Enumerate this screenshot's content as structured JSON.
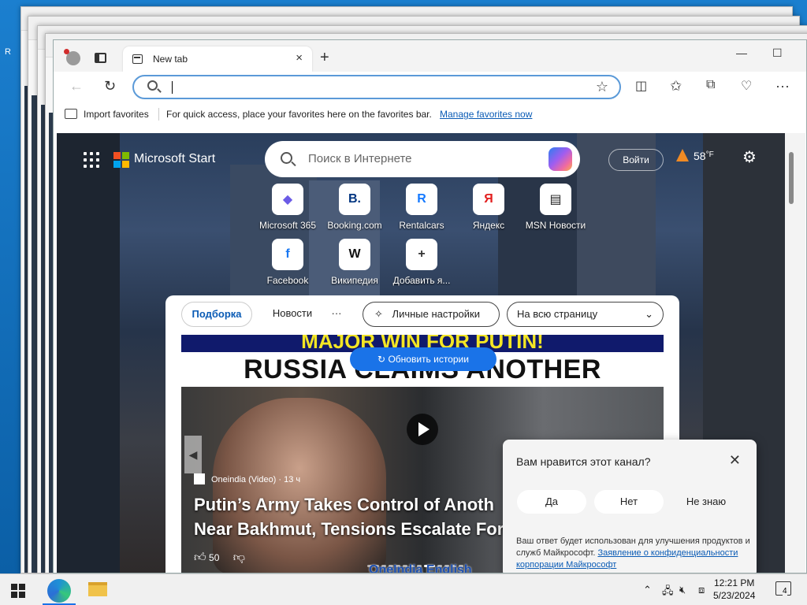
{
  "desktop": {
    "edge_text": "R"
  },
  "browser": {
    "tab": {
      "title": "New tab",
      "close": "×"
    },
    "new_tab": "+",
    "window_controls": {
      "minimize": "—",
      "maximize": "☐"
    },
    "address": {
      "value": "",
      "placeholder": ""
    },
    "favorites_bar": {
      "import_label": "Import favorites",
      "message": "For quick access, place your favorites here on the favorites bar.",
      "manage_link": "Manage favorites now"
    }
  },
  "page": {
    "brand": "Microsoft Start",
    "search_placeholder": "Поиск в Интернете",
    "login": "Войти",
    "weather": {
      "temp": "58",
      "unit": "°F"
    },
    "quick_links": [
      {
        "label": "Microsoft 365",
        "icon": "m365-icon",
        "glyph": "◆",
        "color": "#6b5be6"
      },
      {
        "label": "Booking.com",
        "icon": "booking-icon",
        "glyph": "B.",
        "color": "#003580"
      },
      {
        "label": "Rentalcars",
        "icon": "rentalcars-icon",
        "glyph": "R",
        "color": "#1479ff"
      },
      {
        "label": "Яндекс",
        "icon": "yandex-icon",
        "glyph": "Я",
        "color": "#e21e1e"
      },
      {
        "label": "MSN Новости",
        "icon": "msn-news-icon",
        "glyph": "▤",
        "color": "#222222"
      },
      {
        "label": "Facebook",
        "icon": "facebook-icon",
        "glyph": "f",
        "color": "#1877f2"
      },
      {
        "label": "Википедия",
        "icon": "wikipedia-icon",
        "glyph": "W",
        "color": "#111111"
      },
      {
        "label": "Добавить я...",
        "icon": "add-icon",
        "glyph": "+",
        "color": "#333333"
      }
    ],
    "feed_tabs": {
      "selected": "Подборка",
      "news": "Новости",
      "more": "···",
      "personalize": "Личные настройки",
      "layout": "На всю страницу"
    },
    "article": {
      "banner_top": "MAJOR WIN FOR PUTIN!",
      "banner_main": "RUSSIA CLAIMS ANOTHER SETTLEMENT",
      "refresh": "Обновить истории",
      "source": "Oneindia (Video) · 13 ч",
      "headline_1": "Putin’s Army Takes Control of Anoth",
      "headline_2": "Near Bakhmut, Tensions Escalate For",
      "likes": "50",
      "watermark": "OneIndia English"
    },
    "feedback": {
      "question": "Вам нравится этот канал?",
      "yes": "Да",
      "no": "Нет",
      "dont_know": "Не знаю",
      "note": "Ваш ответ будет использован для улучшения продуктов и служб Майкрософт.",
      "link": "Заявление о конфиденциальности корпорации Майкрософт"
    }
  },
  "taskbar": {
    "time": "12:21 PM",
    "date": "5/23/2024",
    "notification_count": "4"
  },
  "colors": {
    "accent": "#1a73e8",
    "link": "#0a5bb5",
    "ms_red": "#f25022",
    "ms_green": "#7fba00",
    "ms_blue": "#00a4ef",
    "ms_yellow": "#ffb900"
  }
}
